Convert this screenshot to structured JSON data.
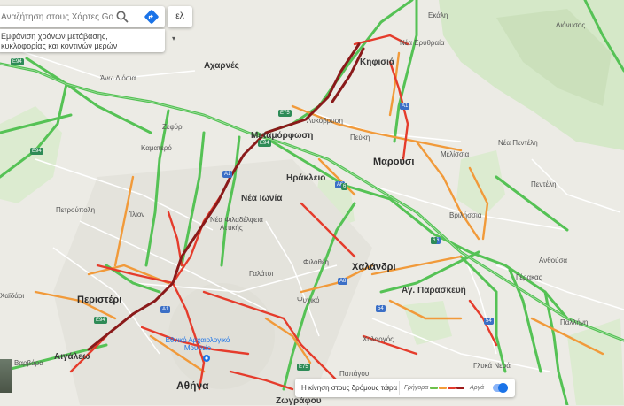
{
  "search": {
    "placeholder": "Αναζήτηση στους Χάρτες Google"
  },
  "hint": {
    "placeholder": "Εμφάνιση χρόνων μετάβασης, κυκλοφορίας και κοντινών μερών"
  },
  "language_button": "ελ",
  "legend": {
    "title": "Η κίνηση στους δρόμους τώρα",
    "fast": "Γρήγορα",
    "slow": "Αργά",
    "colors": [
      "#6cc04a",
      "#f39c38",
      "#e43b2d",
      "#9e1b1b"
    ]
  },
  "traffic_colors": {
    "green": "#55c255",
    "orange": "#f19a3a",
    "red": "#e53c2c",
    "darkred": "#8a1a1a"
  },
  "labels": {
    "ekali": "Εκάλη",
    "dionysos": "Διόνυσος",
    "nea_erythraia": "Νέα Ερυθραία",
    "kifisia": "Κηφισιά",
    "acharnes": "Αχαρνές",
    "ano_liosia": "Άνω Λιόσια",
    "lykovrysi": "Λυκόβρυση",
    "zefyri": "Ζεφύρι",
    "metamorfosi": "Μεταμόρφωση",
    "pefki": "Πεύκη",
    "kamatero": "Καματερό",
    "marousi": "Μαρούσι",
    "melissia": "Μελίσσια",
    "nea_penteli": "Νέα Πεντέλη",
    "irakleio": "Ηράκλειο",
    "penteli": "Πεντέλη",
    "nea_ionia": "Νέα Ιωνία",
    "petroupoli": "Πετρούπολη",
    "ilion": "Ίλιον",
    "vrilissia": "Βριλήσσια",
    "nea_filadelfeia": "Νέα Φιλαδέλφεια",
    "attikis": "Αττικής",
    "anthousa": "Ανθούσα",
    "filothei": "Φιλοθέη",
    "chalandri": "Χαλάνδρι",
    "galatsi": "Γαλάτσι",
    "gerakas": "Γέρακας",
    "chaidari": "Χαϊδάρι",
    "ag_paraskevi": "Αγ. Παρασκευή",
    "peristeri": "Περιστέρι",
    "psychiko": "Ψυχικό",
    "pallini": "Παλλήνη",
    "archaeological_museum": "Εθνικό Αρχαιολογικό Μουσείο",
    "cholargos": "Χολαργός",
    "vyronas_varvara": "Βαρβάρα",
    "aigaleo": "Αιγάλεω",
    "glyka_nera": "Γλυκά Νερά",
    "papagou": "Παπάγου",
    "athina": "Αθήνα",
    "zografou": "Ζωγράφου"
  },
  "shields": [
    "E94",
    "A1",
    "E94",
    "E75",
    "A6",
    "6",
    "A6",
    "E94",
    "A1",
    "A1",
    "E94",
    "A8",
    "6",
    "54",
    "54",
    "E75"
  ]
}
